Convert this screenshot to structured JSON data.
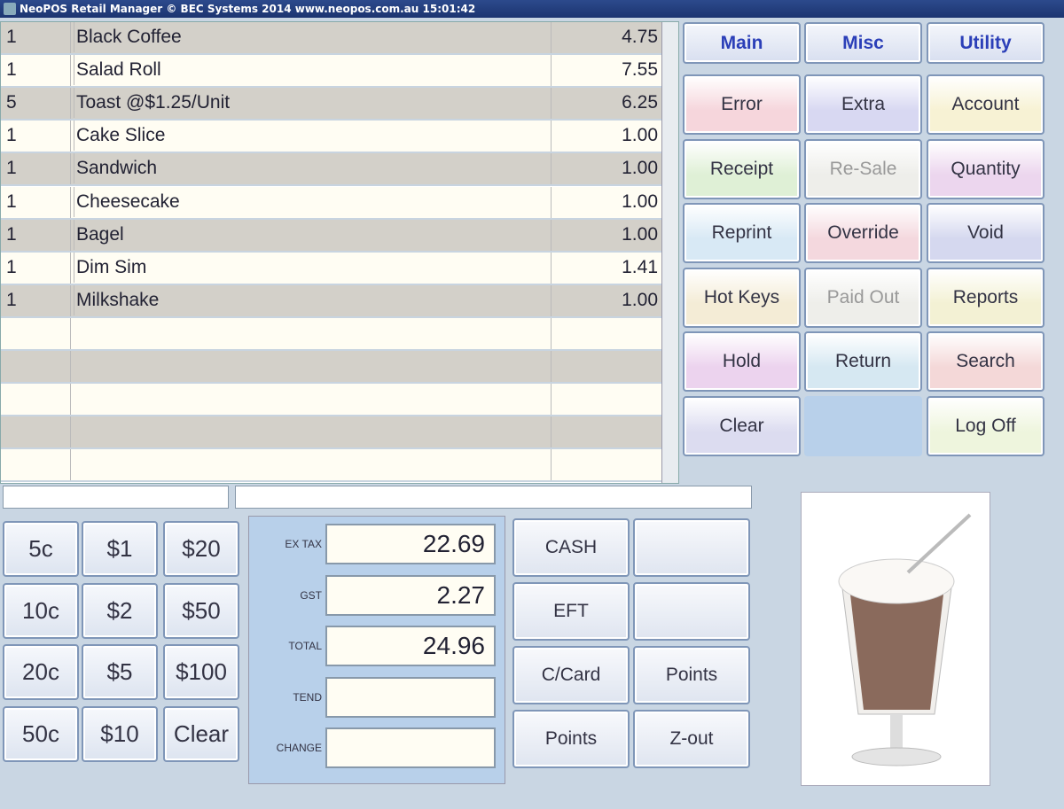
{
  "window": {
    "title": "NeoPOS Retail Manager  © BEC Systems 2014  www.neopos.com.au  15:01:42"
  },
  "items": [
    {
      "qty": "1",
      "name": "Black Coffee",
      "price": "4.75"
    },
    {
      "qty": "1",
      "name": "Salad Roll",
      "price": "7.55"
    },
    {
      "qty": "5",
      "name": "Toast @$1.25/Unit",
      "price": "6.25"
    },
    {
      "qty": "1",
      "name": "Cake Slice",
      "price": "1.00"
    },
    {
      "qty": "1",
      "name": "Sandwich",
      "price": "1.00"
    },
    {
      "qty": "1",
      "name": "Cheesecake",
      "price": "1.00"
    },
    {
      "qty": "1",
      "name": "Bagel",
      "price": "1.00"
    },
    {
      "qty": "1",
      "name": "Dim Sim",
      "price": "1.41"
    },
    {
      "qty": "1",
      "name": "Milkshake",
      "price": "1.00"
    }
  ],
  "tabs": [
    "Main",
    "Misc",
    "Utility"
  ],
  "functions": [
    "Error",
    "Extra",
    "Account",
    "Receipt",
    "Re-Sale",
    "Quantity",
    "Reprint",
    "Override",
    "Void",
    "Hot Keys",
    "Paid Out",
    "Reports",
    "Hold",
    "Return",
    "Search",
    "Clear",
    "",
    "Log Off"
  ],
  "function_colors": [
    "#f6d6dc",
    "#d8d8f2",
    "#f7f2d4",
    "#dff0d6",
    "#eeeeea",
    "#ecd6ee",
    "#d8e9f5",
    "#f4d8de",
    "#d5d8ef",
    "#f4ecd6",
    "#eeeeea",
    "#f3f1d4",
    "#ecd3ee",
    "#d6e8f2",
    "#f4d8d8",
    "#dcdcf0",
    "#b8d0ea",
    "#eef5dd"
  ],
  "keypad": [
    "5c",
    "$1",
    "$20",
    "10c",
    "$2",
    "$50",
    "20c",
    "$5",
    "$100",
    "50c",
    "$10",
    "Clear"
  ],
  "totals": [
    {
      "label": "EX TAX",
      "value": "22.69"
    },
    {
      "label": "GST",
      "value": "2.27"
    },
    {
      "label": "TOTAL",
      "value": "24.96"
    },
    {
      "label": "TEND",
      "value": ""
    },
    {
      "label": "CHANGE",
      "value": ""
    }
  ],
  "payments": [
    "CASH",
    "",
    "EFT",
    "",
    "C/Card",
    "Points",
    "Points",
    "Z-out"
  ]
}
